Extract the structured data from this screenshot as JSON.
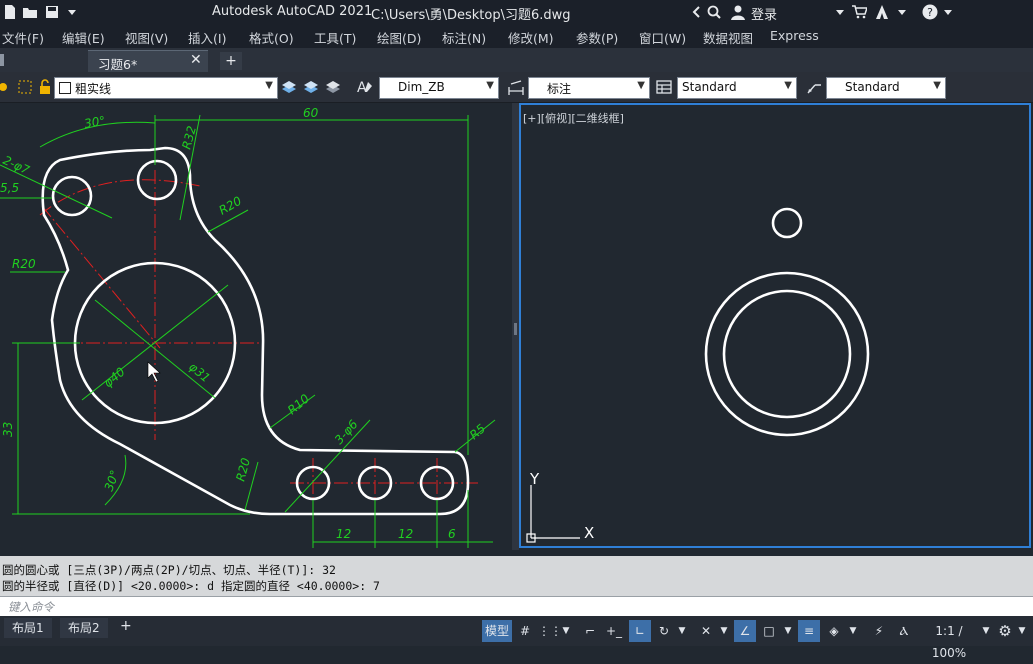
{
  "titlebar": {
    "app_title": "Autodesk AutoCAD 2021",
    "file_path": "C:\\Users\\勇\\Desktop\\习题6.dwg",
    "login_label": "登录"
  },
  "menubar": {
    "items": [
      "文件(F)",
      "编辑(E)",
      "视图(V)",
      "插入(I)",
      "格式(O)",
      "工具(T)",
      "绘图(D)",
      "标注(N)",
      "修改(M)",
      "参数(P)",
      "窗口(W)",
      "数据视图",
      "Express"
    ]
  },
  "tabs": {
    "document_tab": "习题6*",
    "new_tab": "+"
  },
  "toolbar": {
    "layer_name": "粗实线",
    "text_style": "Dim_ZB",
    "dim_style": "标注",
    "table_style": "Standard",
    "multileader_style": "Standard"
  },
  "viewport": {
    "right_label": "[+][俯视][二维线框]",
    "ucs_x": "X",
    "ucs_y": "Y"
  },
  "dimensions": {
    "d60": "60",
    "a30_top": "30°",
    "r32": "R32",
    "d2phi7": "2-φ7",
    "d5_5": "5,5",
    "r20_right": "R20",
    "r20_left": "R20",
    "phi40": "φ40",
    "phi31": "φ31",
    "d33": "33",
    "r10": "R10",
    "d3phi6": "3-φ6",
    "r5": "R5",
    "r20_bottom": "R20",
    "a30_bottom": "30°",
    "d12a": "12",
    "d12b": "12",
    "d6": "6"
  },
  "command": {
    "history_line1": "圆的圆心或 [三点(3P)/两点(2P)/切点、切点、半径(T)]: 32",
    "history_line2": "圆的半径或 [直径(D)] <20.0000>: d 指定圆的直径 <40.0000>: 7",
    "input_placeholder": "键入命令"
  },
  "statusbar": {
    "layout1": "布局1",
    "layout2": "布局2",
    "add_layout": "+",
    "model": "模型",
    "scale": "1:1 / 100%"
  },
  "colors": {
    "dimension": "#20d020",
    "centerline": "#e02020",
    "geometry": "#ffffff",
    "viewport_border": "#2f7fd6"
  }
}
